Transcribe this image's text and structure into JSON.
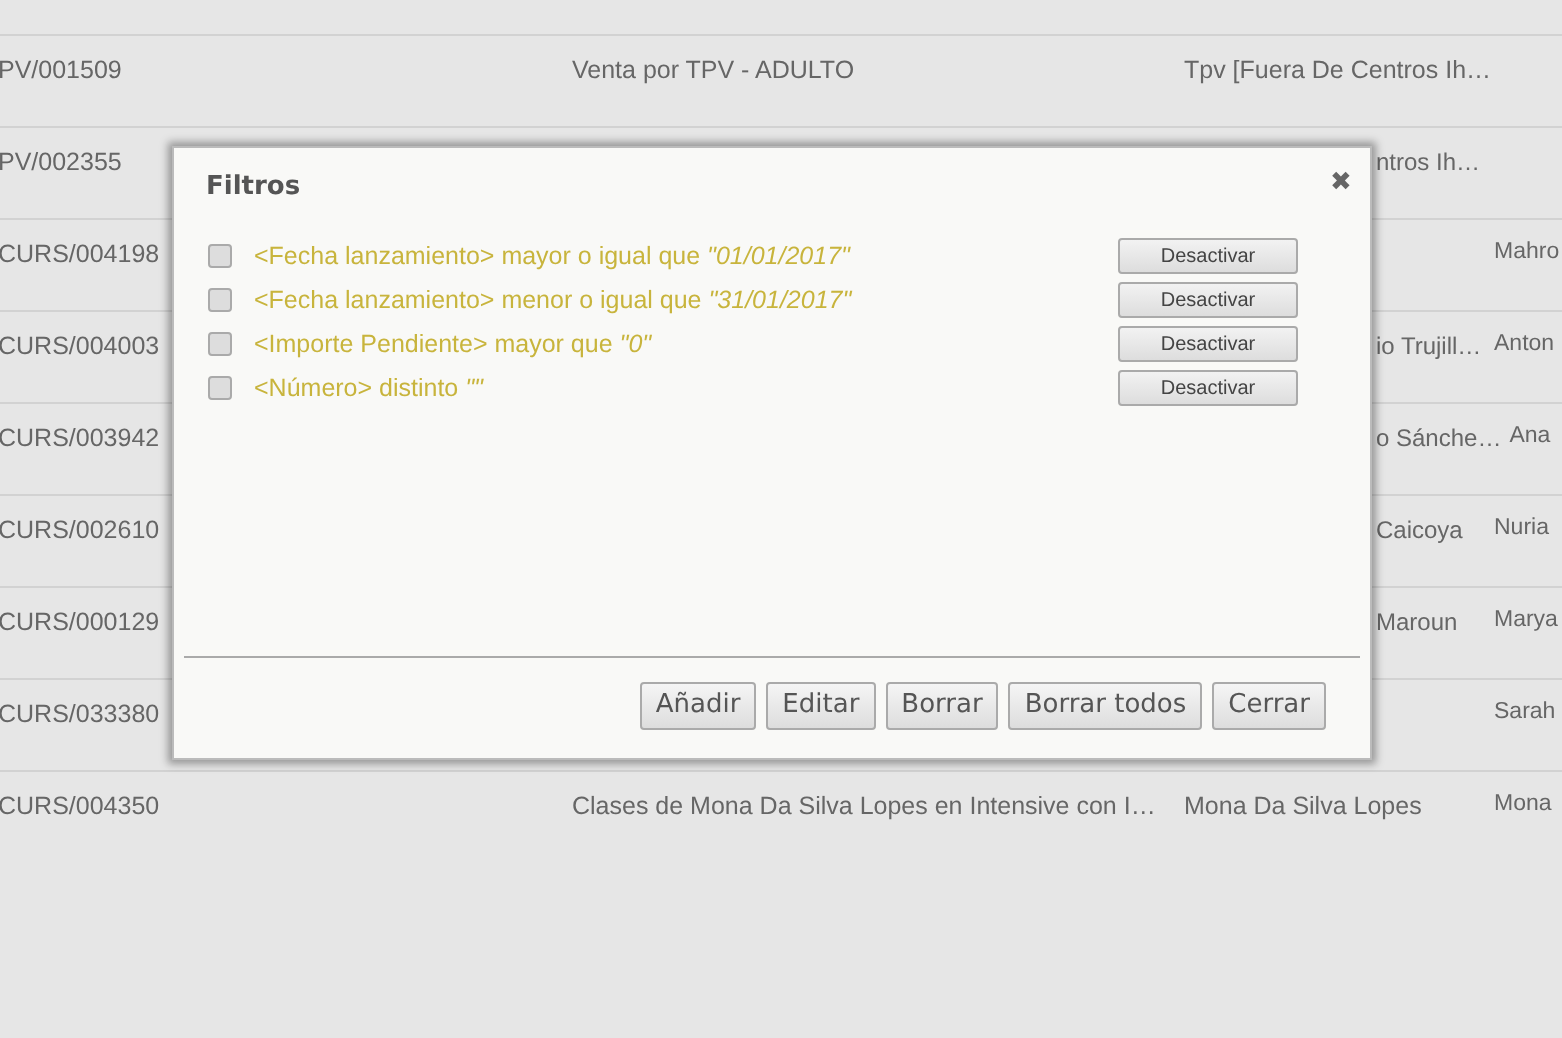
{
  "table": {
    "rows": [
      {
        "column_1": "PV/001509",
        "column_2": "Venta por TPV - ADULTO",
        "column_3": "Tpv [Fuera De Centros Ih…"
      },
      {
        "column_1": "PV/002355",
        "column_3": "ntros Ih…"
      },
      {
        "column_1": "CURS/004198",
        "column_4": "Mahro"
      },
      {
        "column_1": "CURS/004003",
        "column_3": "io Trujill…",
        "column_4": "Anton"
      },
      {
        "column_1": "CURS/003942",
        "column_3": "o Sánche…",
        "column_4": "Ana"
      },
      {
        "column_1": "CURS/002610",
        "column_3": "Caicoya",
        "column_4": "Nuria"
      },
      {
        "column_1": "CURS/000129",
        "column_3": "Maroun",
        "column_4": "Marya"
      },
      {
        "column_1": "CURS/033380",
        "column_4": "Sarah"
      },
      {
        "column_1": "CURS/004350",
        "column_2": "Clases de Mona Da Silva Lopes en Intensive con I…",
        "column_3": "Mona Da Silva Lopes",
        "column_4": "Mona"
      }
    ]
  },
  "dialog": {
    "title": "Filtros",
    "close": "✖",
    "filters": [
      {
        "text": "<Fecha lanzamiento> mayor o igual que *\"01/01/2017\"*",
        "checked": false,
        "button": "Desactivar"
      },
      {
        "text": "<Fecha lanzamiento> menor o igual que *\"31/01/2017\"*",
        "checked": false,
        "button": "Desactivar"
      },
      {
        "text": "<Importe Pendiente> mayor que *\"0\"*",
        "checked": false,
        "button": "Desactivar"
      },
      {
        "text": "<Número> distinto *\"\"*",
        "checked": false,
        "button": "Desactivar"
      }
    ],
    "buttons": [
      "Añadir",
      "Editar",
      "Borrar",
      "Borrar todos",
      "Cerrar"
    ]
  }
}
